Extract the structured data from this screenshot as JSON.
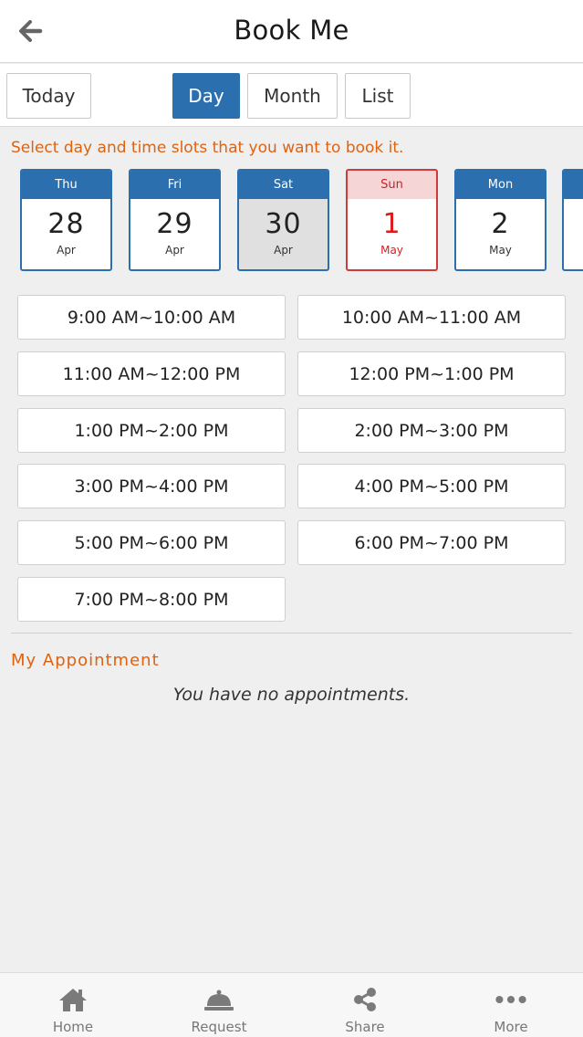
{
  "header": {
    "title": "Book Me",
    "back_icon": "arrow-left-icon"
  },
  "view_bar": {
    "today": "Today",
    "day": "Day",
    "month": "Month",
    "list": "List",
    "active": "Day"
  },
  "instruction": "Select day and time slots that you want to book it.",
  "dates": [
    {
      "dow": "Thu",
      "day": "28",
      "month": "Apr",
      "state": "normal"
    },
    {
      "dow": "Fri",
      "day": "29",
      "month": "Apr",
      "state": "normal"
    },
    {
      "dow": "Sat",
      "day": "30",
      "month": "Apr",
      "state": "selected"
    },
    {
      "dow": "Sun",
      "day": "1",
      "month": "May",
      "state": "weekend"
    },
    {
      "dow": "Mon",
      "day": "2",
      "month": "May",
      "state": "normal"
    }
  ],
  "slots": [
    "9:00 AM~10:00 AM",
    "10:00 AM~11:00 AM",
    "11:00 AM~12:00 PM",
    "12:00 PM~1:00 PM",
    "1:00 PM~2:00 PM",
    "2:00 PM~3:00 PM",
    "3:00 PM~4:00 PM",
    "4:00 PM~5:00 PM",
    "5:00 PM~6:00 PM",
    "6:00 PM~7:00 PM",
    "7:00 PM~8:00 PM"
  ],
  "appointments": {
    "title": "My Appointment",
    "empty": "You have no appointments."
  },
  "nav": [
    {
      "label": "Home",
      "icon": "home-icon"
    },
    {
      "label": "Request",
      "icon": "bell-icon"
    },
    {
      "label": "Share",
      "icon": "share-icon"
    },
    {
      "label": "More",
      "icon": "more-icon"
    }
  ],
  "colors": {
    "primary": "#2b6fae",
    "accent": "#e0620f",
    "weekend": "#e01818"
  }
}
